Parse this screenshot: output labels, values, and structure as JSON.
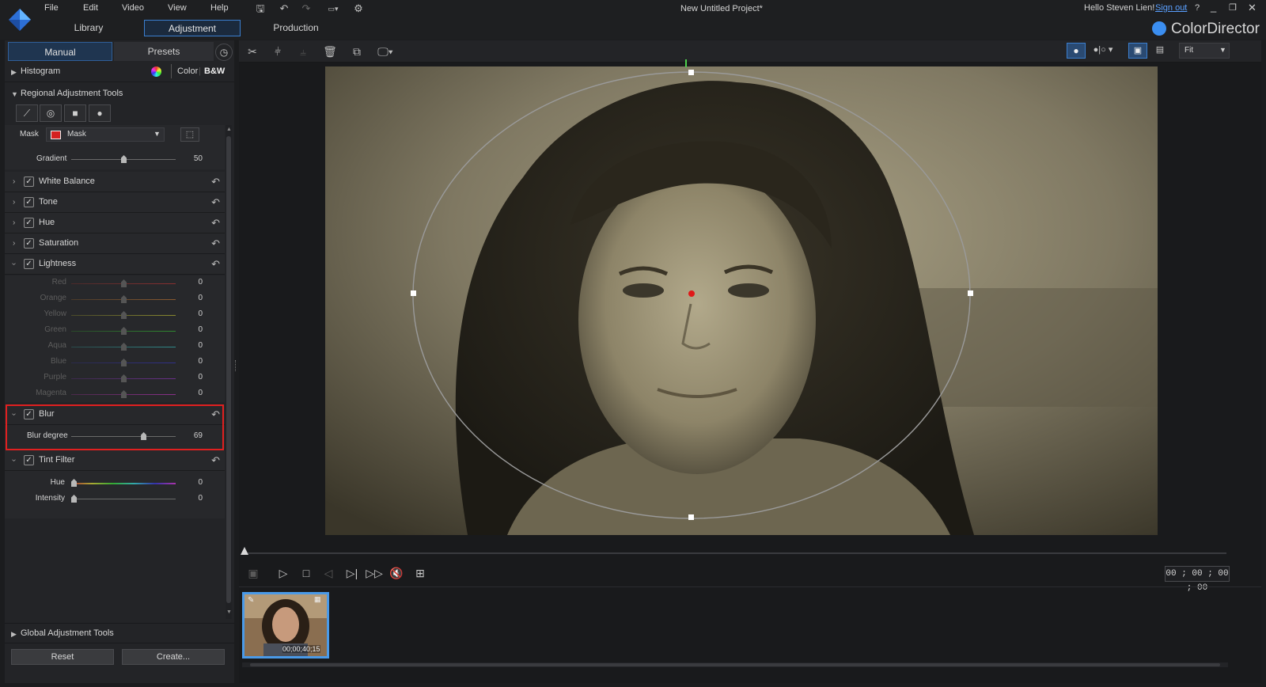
{
  "app": {
    "name": "ColorDirector",
    "project_title": "New Untitled Project*",
    "greeting": "Hello Steven Lien!",
    "sign_out": "Sign out",
    "help": "?",
    "accent": "#3b7fd0"
  },
  "menu": [
    "File",
    "Edit",
    "Video",
    "View",
    "Help"
  ],
  "toolbar_icons": [
    "save-icon",
    "undo-icon",
    "redo-icon",
    "aspect-ratio-icon",
    "settings-icon"
  ],
  "mode_tabs": [
    "Library",
    "Adjustment",
    "Production"
  ],
  "panel": {
    "tabs": [
      "Manual",
      "Presets"
    ],
    "histogram": {
      "label": "Histogram",
      "color_option": "Color",
      "bw_option": "B&W"
    },
    "regional": {
      "title": "Regional Adjustment Tools",
      "mask_label": "Mask",
      "mask_value": "Mask",
      "mask_color": "#d42020",
      "gradient_label": "Gradient",
      "gradient_value": "50",
      "gradient_fraction": 0.5
    },
    "sections": {
      "white_balance": "White Balance",
      "tone": "Tone",
      "hue": "Hue",
      "saturation": "Saturation",
      "lightness": "Lightness",
      "blur": "Blur",
      "tint": "Tint Filter"
    },
    "lightness_rows": [
      {
        "label": "Red",
        "value": "0"
      },
      {
        "label": "Orange",
        "value": "0"
      },
      {
        "label": "Yellow",
        "value": "0"
      },
      {
        "label": "Green",
        "value": "0"
      },
      {
        "label": "Aqua",
        "value": "0"
      },
      {
        "label": "Blue",
        "value": "0"
      },
      {
        "label": "Purple",
        "value": "0"
      },
      {
        "label": "Magenta",
        "value": "0"
      }
    ],
    "blur": {
      "label": "Blur degree",
      "value": "69",
      "fraction": 0.69
    },
    "tint": {
      "hue_label": "Hue",
      "hue_value": "0",
      "intensity_label": "Intensity",
      "intensity_value": "0"
    },
    "global_title": "Global Adjustment Tools",
    "reset": "Reset",
    "create": "Create...",
    "highlight_color": "#e02020"
  },
  "viewer": {
    "zoom": "Fit",
    "timecode": "00 ; 00 ; 00 ; 00",
    "thumb_time": "00;00;40;15"
  }
}
